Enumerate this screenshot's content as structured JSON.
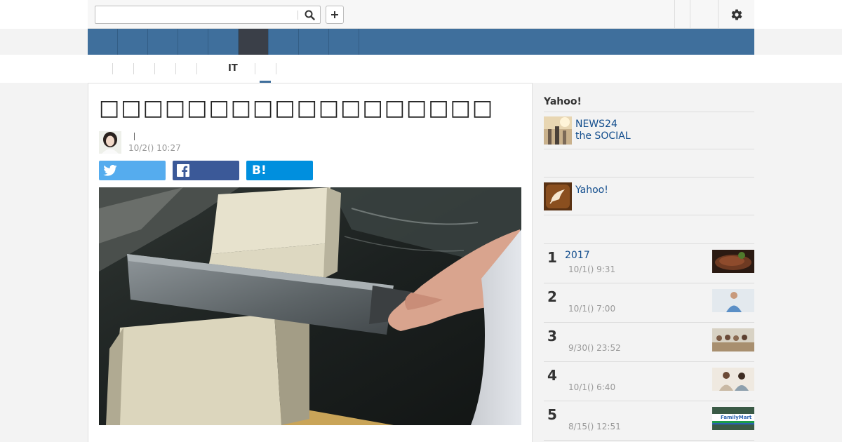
{
  "search": {
    "value": "",
    "placeholder": ""
  },
  "colors": {
    "nav_blue": "#3f6f9c",
    "nav_active": "#3a3f48",
    "twitter": "#55acee",
    "facebook": "#3b5998",
    "hatena": "#008fde",
    "link": "#124d8d"
  },
  "subnav": {
    "active_label": "IT"
  },
  "article": {
    "title": "□□□□□□□□□□□□□□□□□□□",
    "timestamp": "10/2() 10:27",
    "share": {
      "hatena_label": "B!"
    }
  },
  "sidebar": {
    "heading": "Yahoo!",
    "news24": {
      "line1": "NEWS24",
      "line2": "the SOCIAL"
    },
    "yahoo_link": "Yahoo!",
    "ranking": [
      {
        "rank": "1",
        "title": "2017",
        "time": "10/1() 9:31"
      },
      {
        "rank": "2",
        "title": "",
        "time": "10/1() 7:00"
      },
      {
        "rank": "3",
        "title": "",
        "time": "9/30() 23:52"
      },
      {
        "rank": "4",
        "title": "",
        "time": "10/1() 6:40"
      },
      {
        "rank": "5",
        "title": "",
        "time": "8/15() 12:51"
      }
    ],
    "ranking_thumb_text": "FamilyMart"
  }
}
